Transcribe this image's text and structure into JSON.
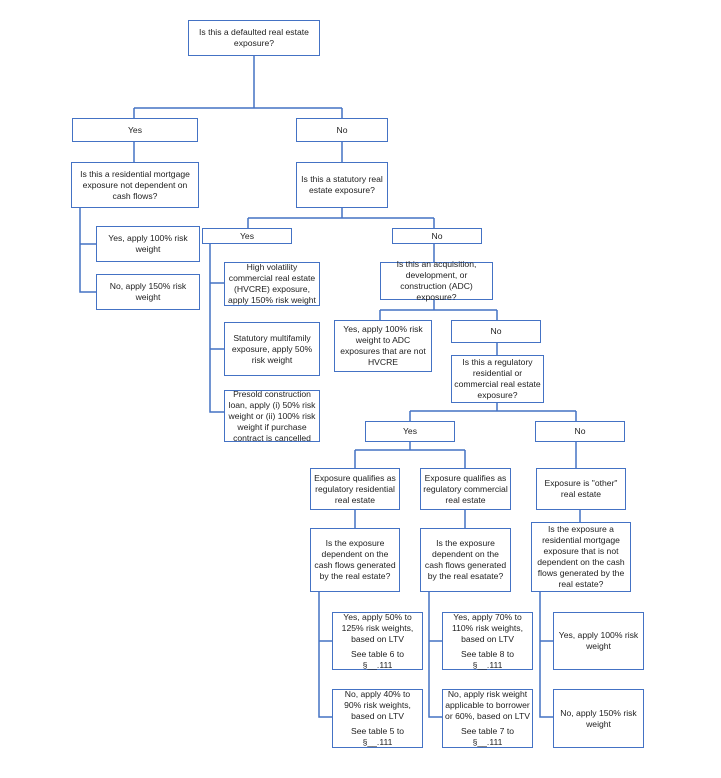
{
  "diagram": {
    "line_color": "#4472c4",
    "nodes": {
      "root": "Is this a defaulted real estate exposure?",
      "defaulted_yes": "Yes",
      "defaulted_no": "No",
      "residential_not_cf_q": "Is this a residential mortgage exposure not dependent on cash flows?",
      "defaulted_yes_100": "Yes, apply 100% risk weight",
      "defaulted_no_150": "No, apply 150% risk weight",
      "statutory_q": "Is this a statutory real estate exposure?",
      "statutory_yes": "Yes",
      "statutory_no": "No",
      "hvcre": "High volatility commercial real estate (HVCRE) exposure, apply 150% risk weight",
      "multifamily": "Statutory multifamily exposure, apply 50% risk weight",
      "presold": "Presold construction loan, apply (i) 50% risk weight or (ii) 100% risk weight if purchase contract is cancelled",
      "adc_q": "Is this an acquisition, development, or construction (ADC) exposure?",
      "adc_yes": "Yes, apply 100% risk weight to ADC exposures that are not HVCRE",
      "adc_no": "No",
      "regulatory_q": "Is this a regulatory residential or commercial real estate exposure?",
      "regulatory_yes": "Yes",
      "regulatory_no": "No",
      "reg_residential": "Exposure qualifies as regulatory residential real estate",
      "reg_commercial": "Exposure qualifies as regulatory commercial real estate",
      "other_re": "Exposure is \"other\" real estate",
      "res_cf_q": "Is the exposure dependent on the cash flows generated by the real estate?",
      "com_cf_q": "Is the exposure dependent on the cash flows generated by the real esatate?",
      "other_q": "Is the exposure a residential mortgage exposure that is not dependent on the cash flows generated by the real estate?",
      "res_yes": "Yes, apply 50% to 125% risk weights, based on LTV",
      "res_yes_ref": "See table 6 to §__.111",
      "res_no": "No, apply 40% to 90% risk weights, based on LTV",
      "res_no_ref": "See table 5 to §__.111",
      "com_yes": "Yes, apply 70% to 110% risk weights, based on LTV",
      "com_yes_ref": "See table 8 to §__.111",
      "com_no": "No, apply risk weight applicable to borrower or 60%, based on LTV",
      "com_no_ref": "See table 7 to §__.111",
      "other_yes": "Yes, apply 100% risk weight",
      "other_no": "No, apply 150% risk weight"
    }
  }
}
